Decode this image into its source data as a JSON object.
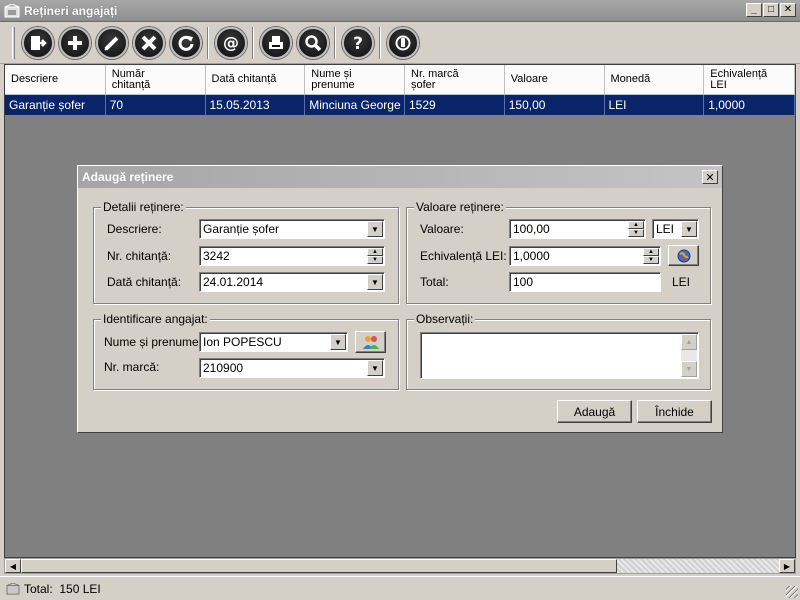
{
  "window": {
    "title": "Rețineri angajați"
  },
  "toolbar": {
    "buttons": [
      {
        "icon": "exit-icon"
      },
      {
        "icon": "add-icon"
      },
      {
        "icon": "edit-icon"
      },
      {
        "icon": "delete-icon"
      },
      {
        "icon": "refresh-icon"
      },
      {
        "icon": "email-icon"
      },
      {
        "icon": "print-icon"
      },
      {
        "icon": "search-icon"
      },
      {
        "icon": "help-icon"
      },
      {
        "icon": "power-icon"
      }
    ]
  },
  "grid": {
    "columns": [
      "Descriere",
      "Număr\nchitanță",
      "Dată chitanță",
      "Nume și\nprenume",
      "Nr. marcă\nșofer",
      "Valoare",
      "Monedă",
      "Echivalență\nLEI"
    ],
    "rows": [
      [
        "Garanție șofer",
        "70",
        "15.05.2013",
        "Minciuna George",
        "1529",
        "150,00",
        "LEI",
        "1,0000"
      ]
    ]
  },
  "statusbar": {
    "total": "Total:  150 LEI"
  },
  "dialog": {
    "title": "Adaugă reținere",
    "details": {
      "legend": "Detalii reținere:",
      "descriere_label": "Descriere:",
      "descriere_value": "Garanție șofer",
      "chitanta_label": "Nr. chitanță:",
      "chitanta_value": "3242",
      "data_label": "Dată chitanță:",
      "data_value": "24.01.2014"
    },
    "valoare": {
      "legend": "Valoare reținere:",
      "valoare_label": "Valoare:",
      "valoare_value": "100,00",
      "moneda_value": "LEI",
      "echiv_label": "Echivalență LEI:",
      "echiv_value": "1,0000",
      "total_label": "Total:",
      "total_value": "100",
      "total_unit": "LEI"
    },
    "angajat": {
      "legend": "Identificare angajat:",
      "nume_label": "Nume și prenume:",
      "nume_value": "Ion POPESCU",
      "marca_label": "Nr. marcă:",
      "marca_value": "210900"
    },
    "observatii": {
      "legend": "Observații:",
      "value": ""
    },
    "buttons": {
      "add": "Adaugă",
      "close": "Închide"
    }
  }
}
